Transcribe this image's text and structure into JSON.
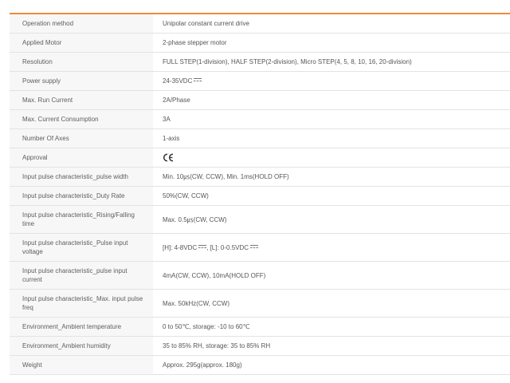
{
  "specs": [
    {
      "label": "Operation method",
      "value": "Unipolar constant current drive"
    },
    {
      "label": "Applied Motor",
      "value": "2-phase stepper motor"
    },
    {
      "label": "Resolution",
      "value": "FULL STEP(1-division), HALF STEP(2-division), Micro STEP(4, 5, 8, 10, 16, 20-division)"
    },
    {
      "label": "Power supply",
      "value": "24-35VDC"
    },
    {
      "label": "Max. Run Current",
      "value": "2A/Phase"
    },
    {
      "label": "Max. Current Consumption",
      "value": "3A"
    },
    {
      "label": "Number Of Axes",
      "value": "1-axis"
    },
    {
      "label": "Approval",
      "value": "CE"
    },
    {
      "label": "Input pulse characteristic_pulse width",
      "value": "Min. 10㎲(CW, CCW), Min. 1ms(HOLD OFF)"
    },
    {
      "label": "Input pulse characteristic_Duty Rate",
      "value": "50%(CW, CCW)"
    },
    {
      "label": "Input pulse characteristic_Rising/Falling time",
      "value": "Max. 0.5㎲(CW, CCW)"
    },
    {
      "label": "Input pulse characteristic_Pulse input voltage",
      "value_high": "[H]: 4-8VDC",
      "value_sep": ", ",
      "value_low": "[L]: 0-0.5VDC"
    },
    {
      "label": "Input pulse characteristic_pulse input current",
      "value": "4mA(CW, CCW), 10mA(HOLD OFF)"
    },
    {
      "label": "Input pulse characteristic_Max. input pulse freq",
      "value": "Max. 50kHz(CW, CCW)"
    },
    {
      "label": "Environment_Ambient temperature",
      "value": "0 to 50℃, storage: -10 to 60℃"
    },
    {
      "label": "Environment_Ambient humidity",
      "value": "35 to 85% RH, storage: 35 to 85% RH"
    },
    {
      "label": "Weight",
      "value": "Approx. 295g(approx. 180g)"
    }
  ],
  "colors": {
    "accent_rule": "#f08a3c",
    "label_bg": "#f7f7f7",
    "border": "#e3e3e3"
  },
  "icons": {
    "dc_symbol": "dc-voltage-icon",
    "approval_mark": "ce-mark-icon"
  }
}
